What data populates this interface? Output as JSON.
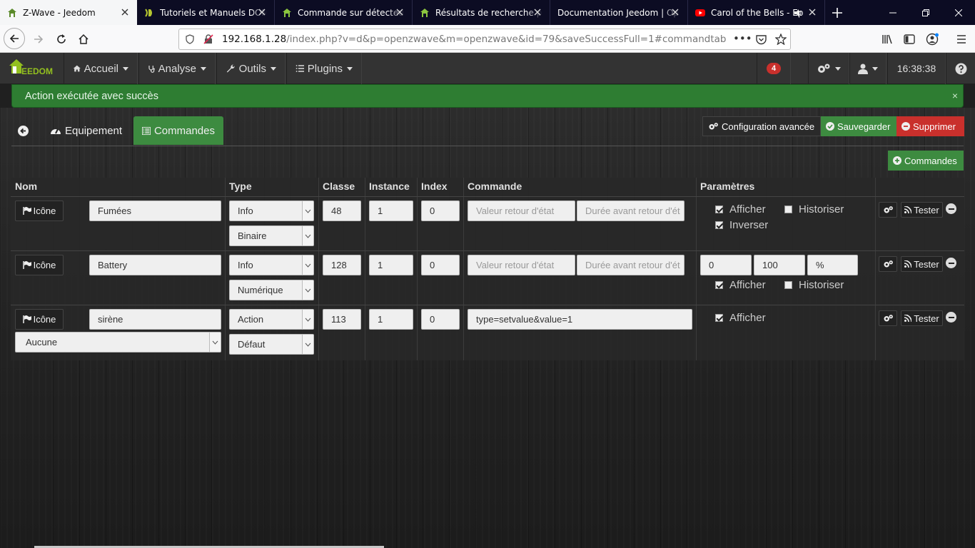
{
  "browser": {
    "tabs": [
      {
        "title": "Z-Wave - Jeedom",
        "active": true,
        "favicon": "jeedom-icon"
      },
      {
        "title": "Tutoriels et Manuels DOMO",
        "active": false,
        "favicon": "domo-icon"
      },
      {
        "title": "Commande sur détecteur",
        "active": false,
        "favicon": "jeedom-icon"
      },
      {
        "title": "Résultats de recherche pour",
        "active": false,
        "favicon": "jeedom-icon"
      },
      {
        "title": "Documentation Jeedom | Op",
        "active": false,
        "favicon": ""
      },
      {
        "title": "Carol of the Bells - Ep",
        "active": false,
        "favicon": "youtube-icon"
      }
    ],
    "url_host": "192.168.1.28",
    "url_path": "/index.php?v=d&p=openzwave&m=openzwave&id=79&saveSuccessFull=1#commandtab",
    "url_more": "•••"
  },
  "jeedom": {
    "logo_text": "EEDOM",
    "menus": [
      {
        "label": "Accueil",
        "icon": "home-icon"
      },
      {
        "label": "Analyse",
        "icon": "stethoscope-icon"
      },
      {
        "label": "Outils",
        "icon": "wrench-icon"
      },
      {
        "label": "Plugins",
        "icon": "list-icon"
      }
    ],
    "notif_count": "4",
    "clock": "16:38:38"
  },
  "alert": {
    "message": "Action exécutée avec succès",
    "close": "×"
  },
  "page_tabs": {
    "back_icon": "back-arrow-icon",
    "equipement": "Equipement",
    "commandes": "Commandes"
  },
  "actions": {
    "config": "Configuration avancée",
    "save": "Sauvegarder",
    "delete": "Supprimer",
    "add_cmd": "Commandes",
    "colors": {
      "save": "#3d8b40",
      "delete": "#c9302c",
      "config": "#2a2a2a"
    }
  },
  "table": {
    "headers": [
      "Nom",
      "Type",
      "Classe",
      "Instance",
      "Index",
      "Commande",
      "Paramètres"
    ],
    "rows": [
      {
        "icon_btn": "Icône",
        "name": "Fumées",
        "type": "Info",
        "subtype": "Binaire",
        "classe": "48",
        "instance": "1",
        "index": "0",
        "cmd_value_placeholder": "Valeur retour d'état",
        "cmd_delay_placeholder": "Durée avant retour d'ét",
        "afficher": "Afficher",
        "historiser": "Historiser",
        "inverser": "Inverser",
        "test": "Tester"
      },
      {
        "icon_btn": "Icône",
        "name": "Battery",
        "type": "Info",
        "subtype": "Numérique",
        "classe": "128",
        "instance": "1",
        "index": "0",
        "cmd_value_placeholder": "Valeur retour d'état",
        "cmd_delay_placeholder": "Durée avant retour d'ét",
        "min": "0",
        "max": "100",
        "unit": "%",
        "afficher": "Afficher",
        "historiser": "Historiser",
        "test": "Tester"
      },
      {
        "icon_btn": "Icône",
        "name": "sirène",
        "linked": "Aucune",
        "type": "Action",
        "subtype": "Défaut",
        "classe": "113",
        "instance": "1",
        "index": "0",
        "command": "type=setvalue&value=1",
        "afficher": "Afficher",
        "test": "Tester"
      }
    ]
  }
}
